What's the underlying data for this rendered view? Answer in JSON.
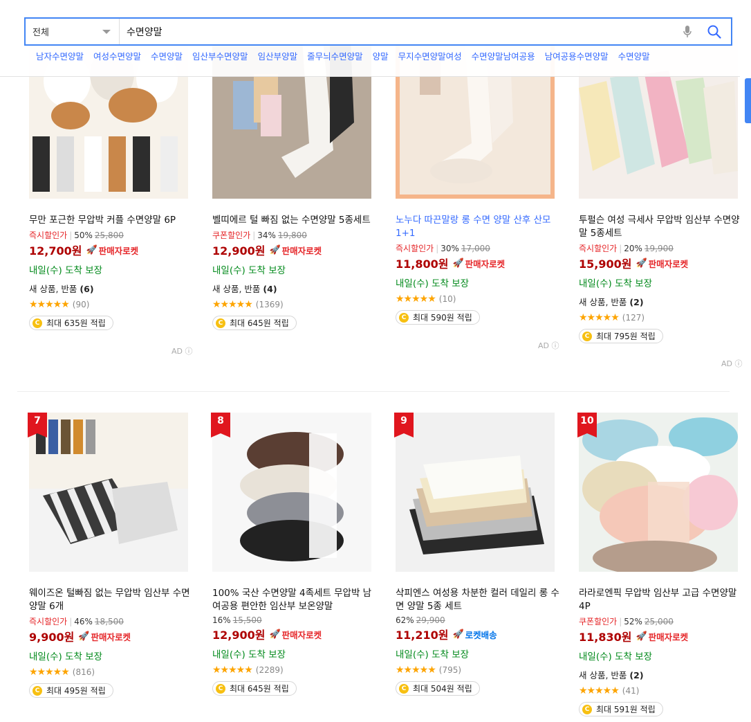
{
  "search": {
    "category": "전체",
    "query": "수면양말",
    "suggestions": [
      "남자수면양말",
      "여성수면양말",
      "수면양말",
      "임산부수면양말",
      "임산부양말",
      "줄무늬수면양말",
      "양말",
      "무지수면양말여성",
      "수면양말남여공용",
      "남여공용수면양말",
      "수면양말"
    ]
  },
  "colors": {
    "accent": "#4285f4",
    "price": "#ae0000",
    "sale": "#e52528",
    "delivery": "#00891a",
    "link": "#346aff",
    "star": "#fda400"
  },
  "ad_label": "AD ⓘ",
  "delivery_label": "내일(수) 도착 보장",
  "products": [
    {
      "title": "무만 포근한 무압박 커플 수면양말 6P",
      "sale_type": "즉시할인가",
      "discount": "50%",
      "original": "25,800",
      "price": "12,700원",
      "badge": "판매자로켓",
      "delivery": "내일(수) 도착 보장",
      "new_product": "새 상품, 반품",
      "new_count": "(6)",
      "rating": 4.5,
      "review_count": "(90)",
      "reward": "최대 635원 적립",
      "ad": true
    },
    {
      "title": "벨띠에르 털 빠짐 없는 수면양말 5종세트",
      "sale_type": "쿠폰할인가",
      "discount": "34%",
      "original": "19,800",
      "price": "12,900원",
      "badge": "판매자로켓",
      "delivery": "내일(수) 도착 보장",
      "new_product": "새 상품, 반품",
      "new_count": "(4)",
      "rating": 4.5,
      "review_count": "(1369)",
      "reward": "최대 645원 적립",
      "ad": false
    },
    {
      "title": "노누다 따끈말랑 롱 수면 양말 산후 산모 1+1",
      "sale_type": "즉시할인가",
      "discount": "30%",
      "original": "17,000",
      "price": "11,800원",
      "badge": "판매자로켓",
      "delivery": "내일(수) 도착 보장",
      "rating": 5,
      "review_count": "(10)",
      "reward": "최대 590원 적립",
      "ad": true
    },
    {
      "title": "투펄슨 여성 극세사 무압박 임산부 수면양말 5종세트",
      "sale_type": "즉시할인가",
      "discount": "20%",
      "original": "19,900",
      "price": "15,900원",
      "badge": "판매자로켓",
      "delivery": "내일(수) 도착 보장",
      "new_product": "새 상품, 반품",
      "new_count": "(2)",
      "rating": 5,
      "review_count": "(127)",
      "reward": "최대 795원 적립",
      "ad": true
    },
    {
      "rank": "7",
      "title": "웨이즈온 털빠짐 없는 무압박 임산부 수면양말 6개",
      "sale_type": "즉시할인가",
      "discount": "46%",
      "original": "18,500",
      "price": "9,900원",
      "badge": "판매자로켓",
      "delivery": "내일(수) 도착 보장",
      "rating": 5,
      "review_count": "(816)",
      "reward": "최대 495원 적립"
    },
    {
      "rank": "8",
      "title": "100% 국산 수면양말 4족세트 무압박 남여공용 편안한 임산부 보온양말",
      "sale_type": "",
      "discount": "16%",
      "original": "15,500",
      "price": "12,900원",
      "badge": "판매자로켓",
      "delivery": "내일(수) 도착 보장",
      "rating": 4.5,
      "review_count": "(2289)",
      "reward": "최대 645원 적립"
    },
    {
      "rank": "9",
      "title": "삭피엔스 여성용 차분한 컬러 데일리 롱 수면 양말 5종 세트",
      "sale_type": "",
      "discount": "62%",
      "original": "29,900",
      "price": "11,210원",
      "badge": "로켓배송",
      "delivery": "내일(수) 도착 보장",
      "rating": 4.5,
      "review_count": "(795)",
      "reward": "최대 504원 적립"
    },
    {
      "rank": "10",
      "title": "라라로엔픽 무압박 임산부 고급 수면양말 4P",
      "sale_type": "쿠폰할인가",
      "discount": "52%",
      "original": "25,000",
      "price": "11,830원",
      "badge": "판매자로켓",
      "delivery": "내일(수) 도착 보장",
      "new_product": "새 상품, 반품",
      "new_count": "(2)",
      "rating": 5,
      "review_count": "(41)",
      "reward": "최대 591원 적립"
    }
  ]
}
